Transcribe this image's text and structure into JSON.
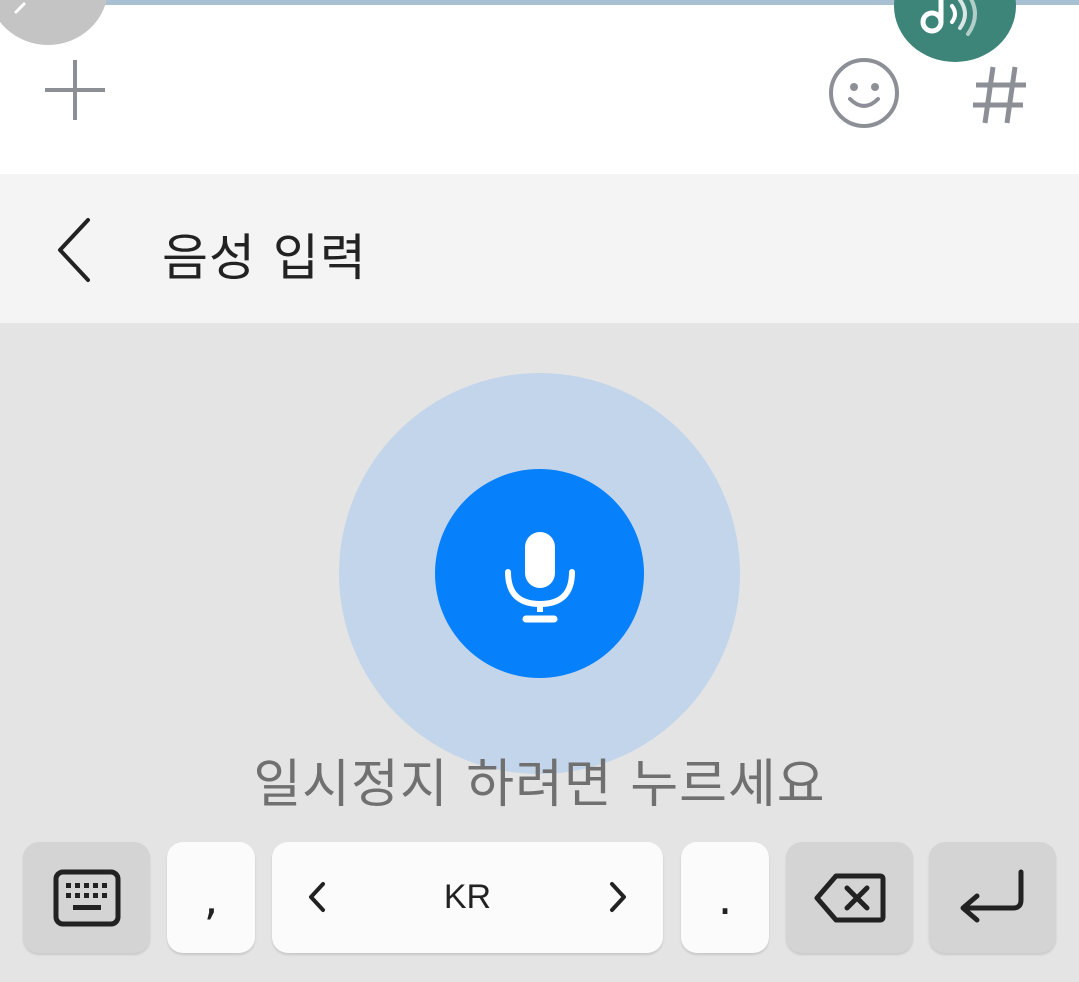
{
  "colors": {
    "accent": "#0780fb",
    "ripple": "#c3d5ea",
    "music_fab": "#3d8579",
    "toolbar_icon": "#8c9096"
  },
  "toolbar": {
    "icons": [
      "plus-icon",
      "emoji-icon",
      "hash-icon",
      "music-note-icon",
      "pen-icon"
    ],
    "hash_label": "#"
  },
  "header": {
    "title": "음성 입력",
    "back_icon": "chevron-left-icon"
  },
  "voice": {
    "mic_icon": "microphone-icon",
    "hint": "일시정지 하려면 누르세요"
  },
  "keyboard": {
    "keyboard_icon": "keyboard-icon",
    "comma": ",",
    "language": "KR",
    "period": ".",
    "backspace_icon": "backspace-icon",
    "enter_icon": "enter-icon"
  }
}
